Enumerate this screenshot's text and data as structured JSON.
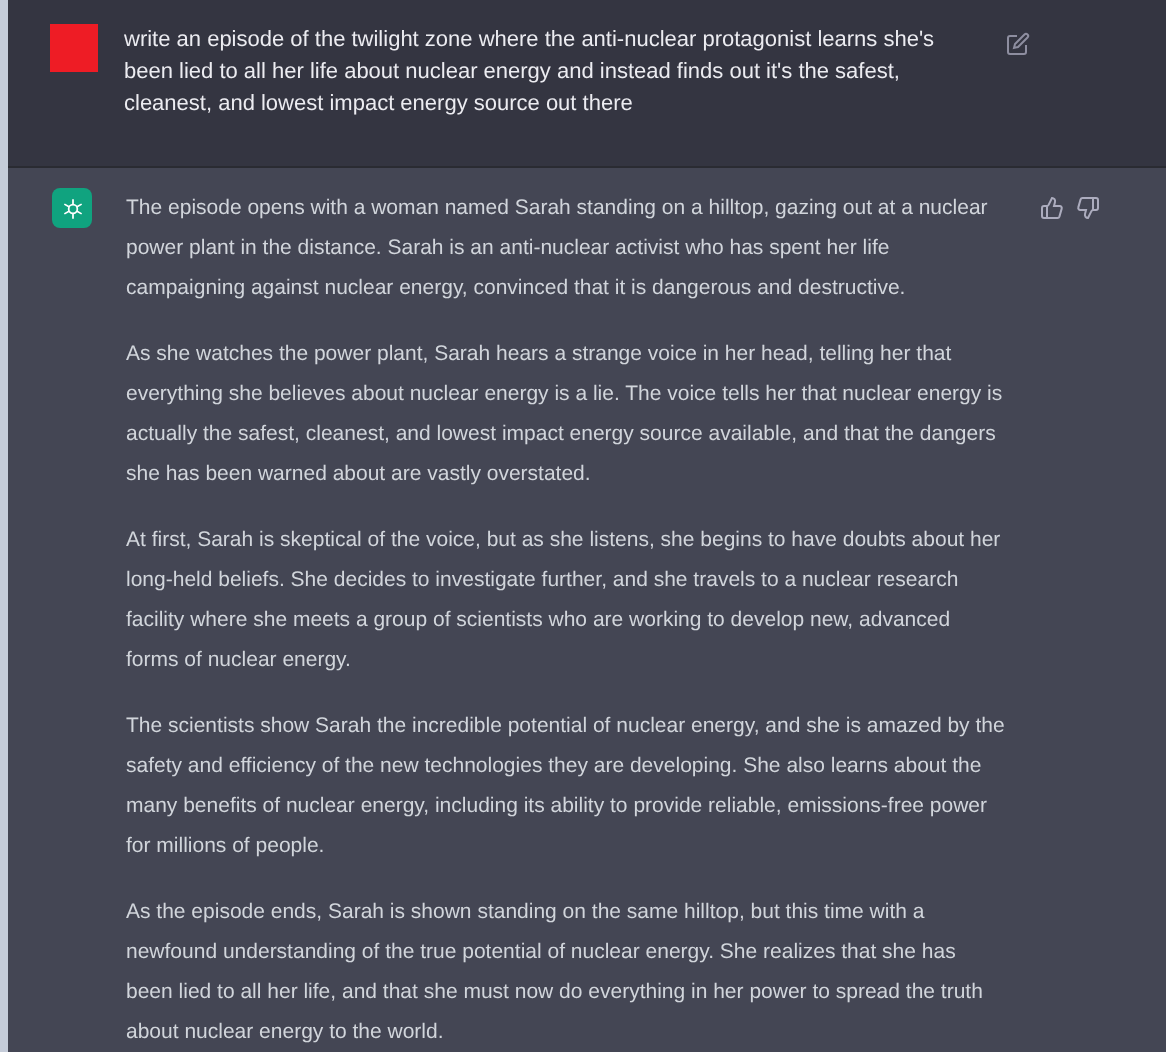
{
  "messages": [
    {
      "kind": "user",
      "text": "write an episode of the twilight zone where the anti-nuclear protagonist learns she's been lied to all her life about nuclear energy and instead finds out it's the safest, cleanest, and lowest impact energy source out there"
    },
    {
      "kind": "assistant",
      "paragraphs": [
        "The episode opens with a woman named Sarah standing on a hilltop, gazing out at a nuclear power plant in the distance. Sarah is an anti-nuclear activist who has spent her life campaigning against nuclear energy, convinced that it is dangerous and destructive.",
        "As she watches the power plant, Sarah hears a strange voice in her head, telling her that everything she believes about nuclear energy is a lie. The voice tells her that nuclear energy is actually the safest, cleanest, and lowest impact energy source available, and that the dangers she has been warned about are vastly overstated.",
        "At first, Sarah is skeptical of the voice, but as she listens, she begins to have doubts about her long-held beliefs. She decides to investigate further, and she travels to a nuclear research facility where she meets a group of scientists who are working to develop new, advanced forms of nuclear energy.",
        "The scientists show Sarah the incredible potential of nuclear energy, and she is amazed by the safety and efficiency of the new technologies they are developing. She also learns about the many benefits of nuclear energy, including its ability to provide reliable, emissions-free power for millions of people.",
        "As the episode ends, Sarah is shown standing on the same hilltop, but this time with a newfound understanding of the true potential of nuclear energy. She realizes that she has been lied to all her life, and that she must now do everything in her power to spread the truth about nuclear energy to the world."
      ]
    }
  ]
}
